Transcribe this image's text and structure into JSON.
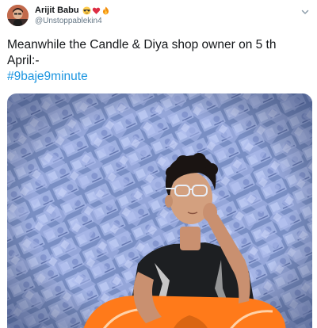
{
  "tweet": {
    "author": {
      "display_name": "Arijit Babu",
      "handle": "@Unstoppablekin4",
      "emojis": [
        "sunglasses-emoji",
        "heart-emoji",
        "fire-emoji"
      ]
    },
    "text_lines": [
      "Meanwhile the Candle & Diya shop owner on 5 th",
      "April:-"
    ],
    "hashtag": "#9baje9minute",
    "colors": {
      "link": "#1b95e0",
      "text": "#14171a",
      "secondary": "#657786"
    }
  }
}
